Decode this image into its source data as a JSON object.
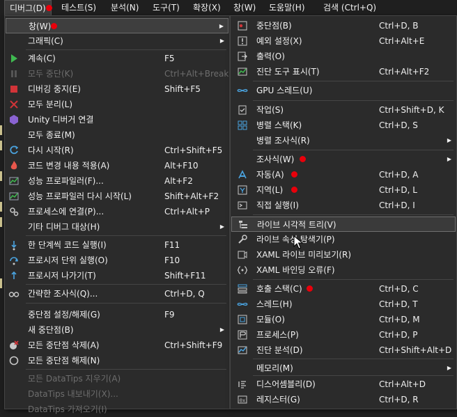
{
  "menubar": {
    "items": [
      "디버그(D)",
      "테스트(S)",
      "분석(N)",
      "도구(T)",
      "확장(X)",
      "창(W)",
      "도움말(H)"
    ],
    "search": "검색 (Ctrl+Q)"
  },
  "debug_menu": {
    "items": [
      {
        "label": "창(W)",
        "shortcut": "",
        "icon": "none",
        "submenu": true
      },
      {
        "label": "그래픽(C)",
        "shortcut": "",
        "icon": "none",
        "submenu": true
      },
      {
        "label": "계속(C)",
        "shortcut": "F5",
        "icon": "play-icon"
      },
      {
        "label": "모두 중단(K)",
        "shortcut": "Ctrl+Alt+Break",
        "icon": "pause-icon"
      },
      {
        "label": "디버깅 중지(E)",
        "shortcut": "Shift+F5",
        "icon": "stop-icon"
      },
      {
        "label": "모두 분리(L)",
        "shortcut": "",
        "icon": "detach-icon"
      },
      {
        "label": "Unity 디버거 연결",
        "shortcut": "",
        "icon": "unity-icon"
      },
      {
        "label": "모두 종료(M)",
        "shortcut": "",
        "icon": "none"
      },
      {
        "label": "다시 시작(R)",
        "shortcut": "Ctrl+Shift+F5",
        "icon": "restart-icon"
      },
      {
        "label": "코드 변경 내용 적용(A)",
        "shortcut": "Alt+F10",
        "icon": "hot-reload-icon"
      },
      {
        "label": "성능 프로파일러(F)...",
        "shortcut": "Alt+F2",
        "icon": "profiler-icon"
      },
      {
        "label": "성능 프로파일러 다시 시작(L)",
        "shortcut": "Shift+Alt+F2",
        "icon": "profiler-restart-icon"
      },
      {
        "label": "프로세스에 연결(P)...",
        "shortcut": "Ctrl+Alt+P",
        "icon": "attach-icon"
      },
      {
        "label": "기타 디버그 대상(H)",
        "shortcut": "",
        "icon": "none",
        "submenu": true
      },
      {
        "label": "한 단계씩 코드 실행(I)",
        "shortcut": "F11",
        "icon": "step-into-icon"
      },
      {
        "label": "프로시저 단위 실행(O)",
        "shortcut": "F10",
        "icon": "step-over-icon"
      },
      {
        "label": "프로시저 나가기(T)",
        "shortcut": "Shift+F11",
        "icon": "step-out-icon"
      },
      {
        "label": "간략한 조사식(Q)...",
        "shortcut": "Ctrl+D, Q",
        "icon": "quickwatch-icon"
      },
      {
        "label": "중단점 설정/해제(G)",
        "shortcut": "F9",
        "icon": "none"
      },
      {
        "label": "새 중단점(B)",
        "shortcut": "",
        "icon": "none",
        "submenu": true
      },
      {
        "label": "모든 중단점 삭제(A)",
        "shortcut": "Ctrl+Shift+F9",
        "icon": "delete-breakpoints-icon"
      },
      {
        "label": "모든 중단점 해제(N)",
        "shortcut": "",
        "icon": "disable-breakpoints-icon"
      },
      {
        "label": "모든 DataTips 지우기(A)",
        "shortcut": "",
        "icon": "none"
      },
      {
        "label": "DataTips 내보내기(X)...",
        "shortcut": "",
        "icon": "none"
      },
      {
        "label": "DataTips 가져오기(I)",
        "shortcut": "",
        "icon": "none"
      }
    ]
  },
  "window_submenu": {
    "items": [
      {
        "label": "중단점(B)",
        "shortcut": "Ctrl+D, B",
        "icon": "breakpoints-window-icon"
      },
      {
        "label": "예외 설정(X)",
        "shortcut": "Ctrl+Alt+E",
        "icon": "exception-settings-icon"
      },
      {
        "label": "출력(O)",
        "shortcut": "",
        "icon": "output-icon"
      },
      {
        "label": "진단 도구 표시(T)",
        "shortcut": "Ctrl+Alt+F2",
        "icon": "diagnostic-tools-icon"
      },
      {
        "label": "GPU 스레드(U)",
        "shortcut": "",
        "icon": "gpu-threads-icon"
      },
      {
        "label": "작업(S)",
        "shortcut": "Ctrl+Shift+D, K",
        "icon": "tasks-icon"
      },
      {
        "label": "병렬 스택(K)",
        "shortcut": "Ctrl+D, S",
        "icon": "parallel-stacks-icon"
      },
      {
        "label": "병렬 조사식(R)",
        "shortcut": "",
        "icon": "none",
        "submenu": true
      },
      {
        "label": "조사식(W)",
        "shortcut": "",
        "icon": "none",
        "submenu": true
      },
      {
        "label": "자동(A)",
        "shortcut": "Ctrl+D, A",
        "icon": "autos-icon"
      },
      {
        "label": "지역(L)",
        "shortcut": "Ctrl+D, L",
        "icon": "locals-icon"
      },
      {
        "label": "직접 실행(I)",
        "shortcut": "Ctrl+D, I",
        "icon": "immediate-icon"
      },
      {
        "label": "라이브 시각적 트리(V)",
        "shortcut": "",
        "icon": "live-visual-tree-icon"
      },
      {
        "label": "라이브 속성 탐색기(P)",
        "shortcut": "",
        "icon": "live-property-explorer-icon"
      },
      {
        "label": "XAML 라이브 미리보기(R)",
        "shortcut": "",
        "icon": "xaml-preview-icon"
      },
      {
        "label": "XAML 바인딩 오류(F)",
        "shortcut": "",
        "icon": "xaml-binding-icon"
      },
      {
        "label": "호출 스택(C)",
        "shortcut": "Ctrl+D, C",
        "icon": "call-stack-icon"
      },
      {
        "label": "스레드(H)",
        "shortcut": "Ctrl+D, T",
        "icon": "threads-icon"
      },
      {
        "label": "모듈(O)",
        "shortcut": "Ctrl+D, M",
        "icon": "modules-icon"
      },
      {
        "label": "프로세스(P)",
        "shortcut": "Ctrl+D, P",
        "icon": "processes-icon"
      },
      {
        "label": "진단 분석(D)",
        "shortcut": "Ctrl+Shift+Alt+D",
        "icon": "diagnostic-analysis-icon"
      },
      {
        "label": "메모리(M)",
        "shortcut": "",
        "icon": "none",
        "submenu": true
      },
      {
        "label": "디스어셈블리(D)",
        "shortcut": "Ctrl+Alt+D",
        "icon": "disassembly-icon"
      },
      {
        "label": "레지스터(G)",
        "shortcut": "Ctrl+D, R",
        "icon": "registers-icon"
      }
    ]
  },
  "colors": {
    "accent": "#e8000b",
    "menu_bg": "#2b2b2b",
    "disabled": "#6d6d6d"
  }
}
